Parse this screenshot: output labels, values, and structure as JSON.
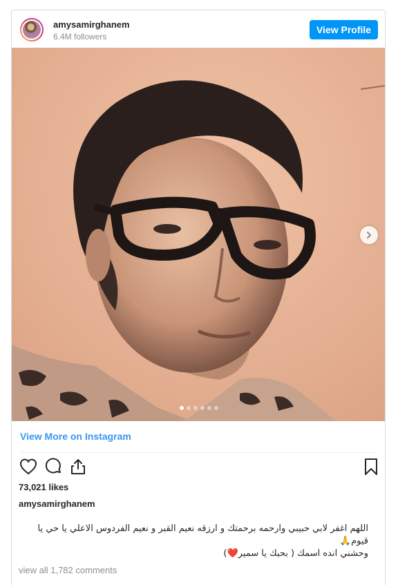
{
  "post": {
    "username": "amysamirghanem",
    "followers": "6.4M followers",
    "view_profile_label": "View Profile",
    "view_more_label": "View More on Instagram",
    "likes": "73,021 likes",
    "caption_user": "amysamirghanem",
    "caption_line1": "اللهم اغفر لابي حبيبي وارحمه برحمتك و ارزقه نعيم القبر و نعيم الفردوس الاعلي يا حي يا قيوم🙏",
    "caption_line2": "وحشني انده اسمك ( بحبك يا سمير❤️)",
    "view_all_comments": "view all 1,782 comments",
    "carousel": {
      "slides": 6,
      "active_index": 0
    }
  },
  "icons": {
    "avatar": "avatar-image",
    "next": "chevron-right-icon",
    "like": "heart-outline-icon",
    "comment": "comment-bubble-icon",
    "share": "share-upload-icon",
    "save": "bookmark-icon"
  },
  "colors": {
    "accent": "#0095f6",
    "link": "#3897f0",
    "muted": "#8e8e8e",
    "photo_tint": "#e7b497"
  }
}
